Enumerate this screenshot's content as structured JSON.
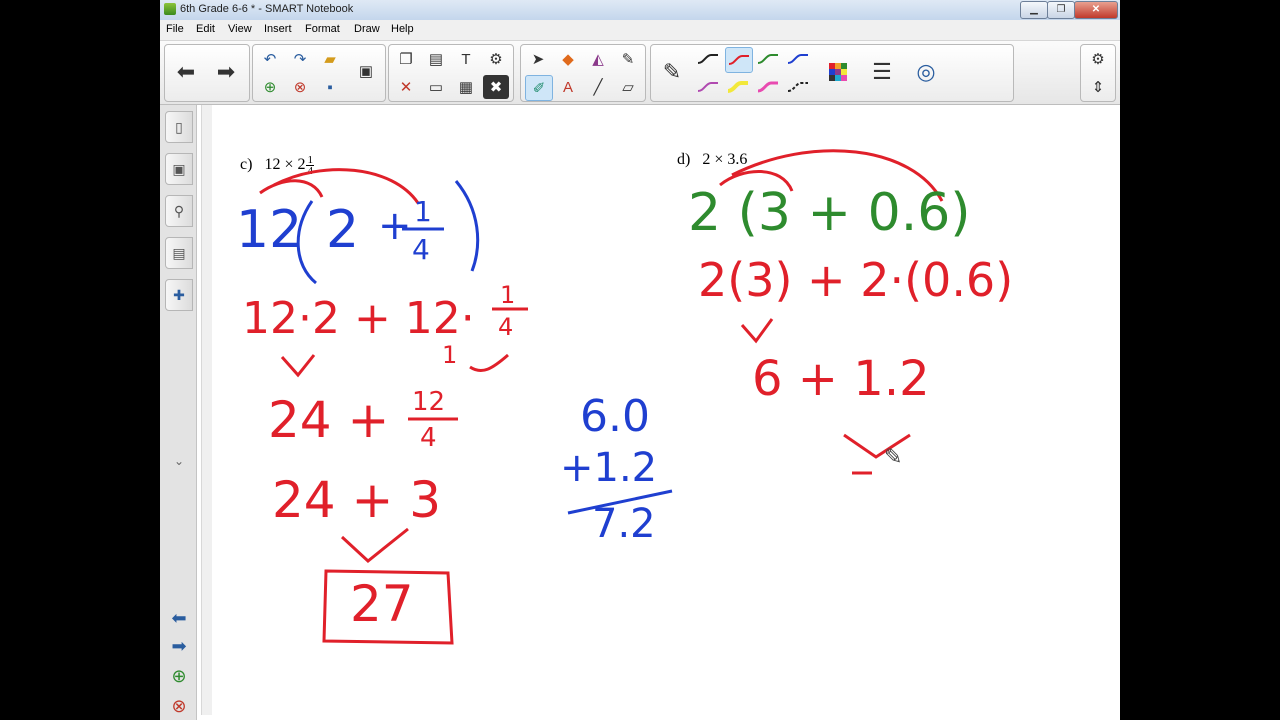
{
  "window": {
    "title": "6th Grade 6-6 * - SMART Notebook"
  },
  "menu": [
    "File",
    "Edit",
    "View",
    "Insert",
    "Format",
    "Draw",
    "Help"
  ],
  "problems": {
    "c": {
      "label": "c)",
      "expression": "12 × 2",
      "frac_num": "1",
      "frac_den": "4"
    },
    "d": {
      "label": "d)",
      "expression": "2 × 3.6"
    }
  },
  "handwriting": {
    "c_line1_whole": "12",
    "c_line1_a": "2",
    "c_line1_plus": "+",
    "c_line1_num": "1",
    "c_line1_den": "4",
    "c_line2": "12·2 + 12·",
    "c_line2_num": "1",
    "c_line2_den": "4",
    "c_line2_note": "1",
    "c_line3": "24 +",
    "c_line3_num": "12",
    "c_line3_den": "4",
    "c_line4": "24 + 3",
    "c_answer": "27",
    "side_top": "6.0",
    "side_add": "+1.2",
    "side_sum": "7.2",
    "d_line1": "2 (3 + 0.6)",
    "d_line2": "2(3) + 2·(0.6)",
    "d_line3": "6 + 1.2"
  },
  "colors": {
    "red": "#e0202a",
    "blue": "#1f3fd0",
    "green": "#2e8b2e"
  }
}
